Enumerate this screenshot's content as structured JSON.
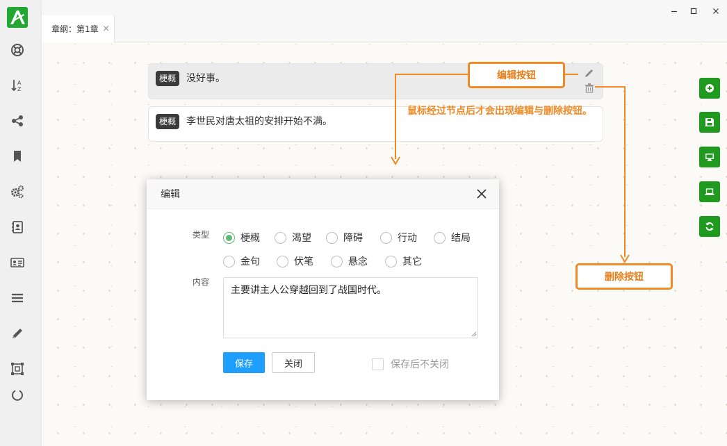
{
  "app": {
    "tab_title": "章纲：第1章",
    "tab_close": "×",
    "colors": {
      "brand": "#22a832",
      "action_green": "#1f9a1f",
      "annotation": "#f08a24",
      "primary": "#1e9fff"
    }
  },
  "sidebar": {
    "items": [
      {
        "icon": "help-ring-icon"
      },
      {
        "icon": "sort-az-icon"
      },
      {
        "icon": "share-icon"
      },
      {
        "icon": "bookmark-icon"
      },
      {
        "icon": "gears-icon"
      },
      {
        "icon": "contact-book-icon"
      },
      {
        "icon": "id-card-icon"
      },
      {
        "icon": "list-icon"
      },
      {
        "icon": "pencil-icon"
      },
      {
        "icon": "frame-select-icon"
      },
      {
        "icon": "power-icon"
      }
    ]
  },
  "nodes": [
    {
      "tag": "梗概",
      "text": "没好事。"
    },
    {
      "tag": "梗概",
      "text": "李世民对唐太祖的安排开始不满。"
    }
  ],
  "right_toolbar": [
    {
      "icon": "add-circle-icon"
    },
    {
      "icon": "save-icon"
    },
    {
      "icon": "monitor-icon"
    },
    {
      "icon": "laptop-icon"
    },
    {
      "icon": "refresh-icon"
    }
  ],
  "annotations": {
    "edit_callout": "编辑按钮",
    "hover_note": "鼠标经过节点后才会出现编辑与删除按钮。",
    "delete_callout": "删除按钮"
  },
  "dialog": {
    "title": "编辑",
    "type_label": "类型",
    "content_label": "内容",
    "types": [
      "梗概",
      "渴望",
      "障碍",
      "行动",
      "结局",
      "金句",
      "伏笔",
      "悬念",
      "其它"
    ],
    "selected_type": "梗概",
    "content": "主要讲主人公穿越回到了战国时代。",
    "save_label": "保存",
    "close_label": "关闭",
    "keep_open_label": "保存后不关闭"
  }
}
